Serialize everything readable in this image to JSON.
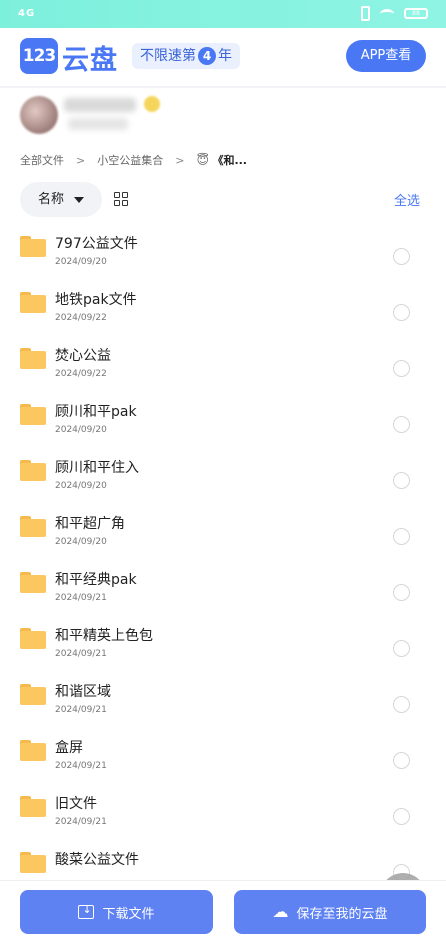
{
  "status_bar": {
    "signal": "4G",
    "battery": "88"
  },
  "header": {
    "logo_number": "123",
    "logo_text": "云盘",
    "promo_prefix": "不限速第",
    "promo_number": "4",
    "promo_suffix": "年",
    "app_button": "APP查看"
  },
  "breadcrumb": {
    "root": "全部文件",
    "sep1": ">",
    "level1": "小空公益集合",
    "sep2": ">",
    "current_emoji": "😇",
    "current": "《和..."
  },
  "toolbar": {
    "sort_label": "名称",
    "select_all": "全选"
  },
  "files": [
    {
      "name": "797公益文件",
      "date": "2024/09/20"
    },
    {
      "name": "地铁pak文件",
      "date": "2024/09/22"
    },
    {
      "name": "焚心公益",
      "date": "2024/09/22"
    },
    {
      "name": "顾川和平pak",
      "date": "2024/09/20"
    },
    {
      "name": "顾川和平住入",
      "date": "2024/09/20"
    },
    {
      "name": "和平超广角",
      "date": "2024/09/20"
    },
    {
      "name": "和平经典pak",
      "date": "2024/09/21"
    },
    {
      "name": "和平精英上色包",
      "date": "2024/09/21"
    },
    {
      "name": "和谐区域",
      "date": "2024/09/21"
    },
    {
      "name": "盒屏",
      "date": "2024/09/21"
    },
    {
      "name": "旧文件",
      "date": "2024/09/21"
    },
    {
      "name": "酸菜公益文件",
      "date": ""
    }
  ],
  "bottom": {
    "download_label": "下载文件",
    "save_label": "保存至我的云盘"
  },
  "colors": {
    "accent": "#4a78f5",
    "button": "#5f82f3",
    "folder": "#fbc75f",
    "status_bar": "#7df0dc"
  }
}
